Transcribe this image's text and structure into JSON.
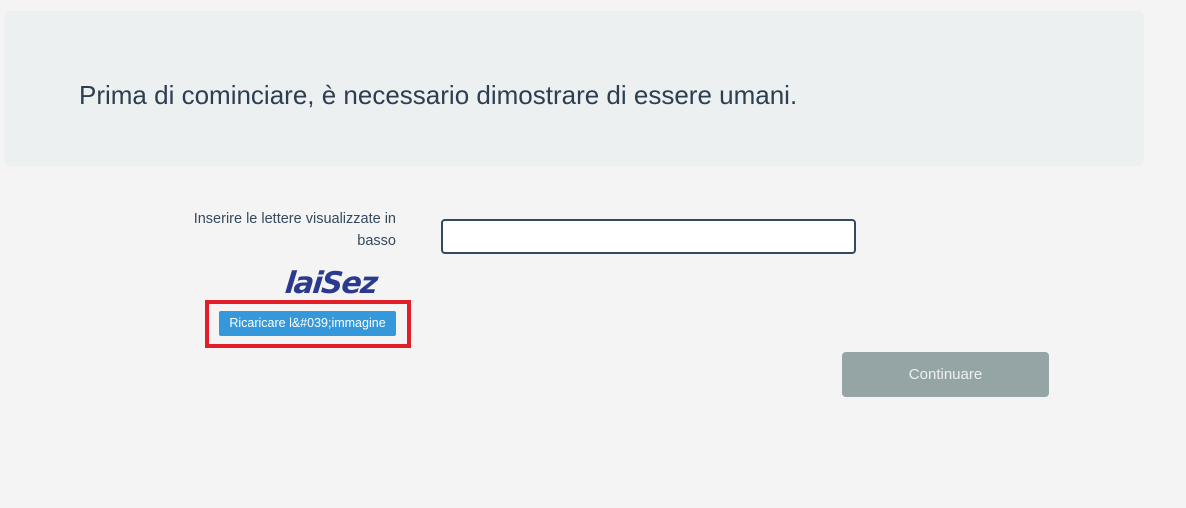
{
  "banner": {
    "title": "Prima di cominciare, è necessario dimostrare di essere umani."
  },
  "form": {
    "label": "Inserire le lettere visualizzate in basso",
    "input_value": "",
    "input_placeholder": ""
  },
  "captcha": {
    "text": "laiSez",
    "color": "#2b3a8f"
  },
  "buttons": {
    "reload_label": "Ricaricare l&#039;immagine",
    "continue_label": "Continuare"
  },
  "colors": {
    "page_background": "#f4f4f4",
    "banner_background": "#ecf0f1",
    "text": "#2c3e50",
    "reload_button": "#3498db",
    "continue_button": "#95a5a6",
    "highlight_frame": "#e41e26"
  }
}
